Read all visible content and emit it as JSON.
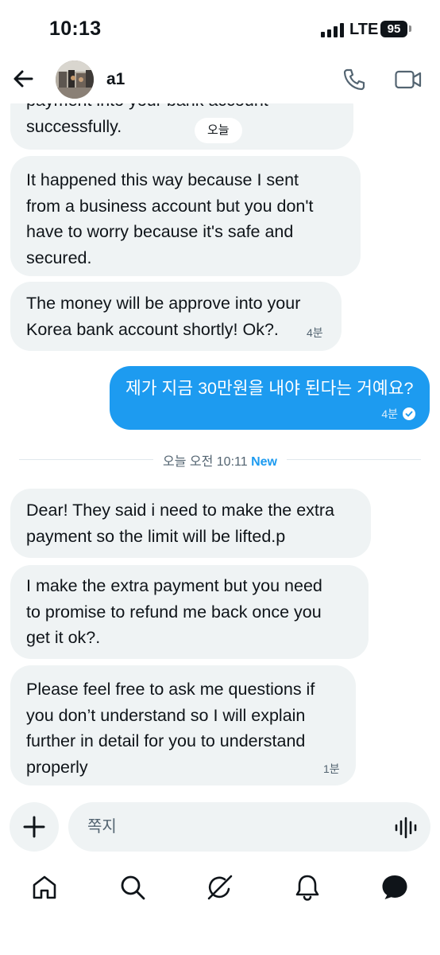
{
  "status_bar": {
    "time": "10:13",
    "network": "LTE",
    "battery": "95"
  },
  "header": {
    "contact_name": "a1"
  },
  "messages": [
    {
      "id": "m1",
      "direction": "in",
      "lines": [
        "payment into your bank account",
        "successfully."
      ],
      "pill": "오늘"
    },
    {
      "id": "m2",
      "direction": "in",
      "lines": [
        "It happened this way because I sent",
        "from a business account but you don't",
        "have to worry because it's safe and",
        "secured."
      ]
    },
    {
      "id": "m3",
      "direction": "in",
      "lines": [
        "The money will be approve into your",
        "Korea bank account shortly! Ok?."
      ],
      "time": "4분"
    },
    {
      "id": "m4",
      "direction": "out",
      "lines": [
        "제가 지금 30만원을 내야 된다는 거예요?"
      ],
      "time": "4분",
      "read": true
    },
    {
      "id": "m5",
      "direction": "in",
      "lines": [
        "Dear! They said i need to make the extra",
        "payment so the limit will be lifted.p"
      ]
    },
    {
      "id": "m6",
      "direction": "in",
      "lines": [
        "I  make the extra payment but you need",
        "to promise to refund me back once you",
        "get it ok?."
      ]
    },
    {
      "id": "m7",
      "direction": "in",
      "lines": [
        "Please feel free to ask me questions if",
        "you don’t understand so I will explain",
        "further in detail for you to understand",
        "properly"
      ],
      "time": "1분"
    }
  ],
  "divider": {
    "label": "오늘 오전 10:11",
    "new_label": "New"
  },
  "composer": {
    "placeholder": "쪽지"
  },
  "tabs": [
    "home-icon",
    "search-icon",
    "grok-icon",
    "notifications-icon",
    "messages-icon"
  ],
  "colors": {
    "accent": "#1d9bf0",
    "bubble_in": "#eff3f4",
    "text": "#0f1419",
    "muted": "#536471"
  }
}
